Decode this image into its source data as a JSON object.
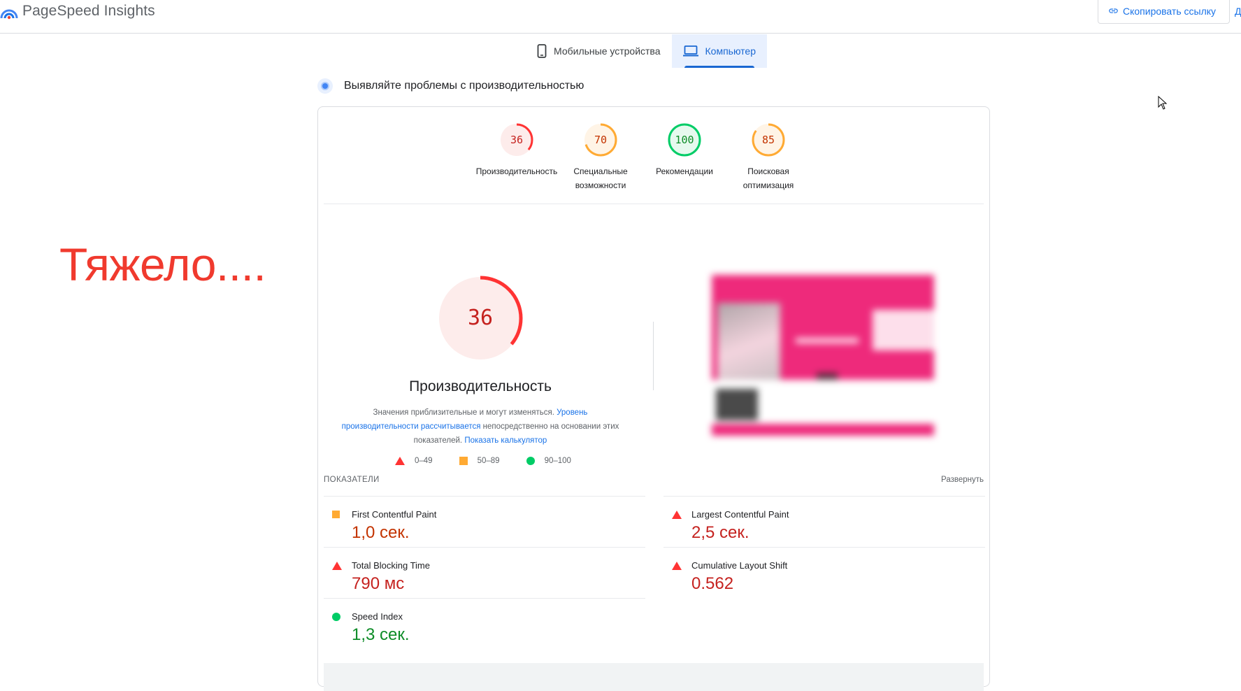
{
  "header": {
    "app_title": "PageSpeed Insights",
    "copy_link_label": "Скопировать ссылку",
    "edge_letter": "Д"
  },
  "tabs": [
    {
      "label": "Мобильные устройства",
      "active": false
    },
    {
      "label": "Компьютер",
      "active": true
    }
  ],
  "section_title": "Выявляйте проблемы с производительностью",
  "caption": "Тяжело....",
  "categories": [
    {
      "score": "36",
      "label": "Производительность",
      "level": "fail",
      "fraction": 0.36
    },
    {
      "score": "70",
      "label": "Специальные возможности",
      "level": "average",
      "fraction": 0.7
    },
    {
      "score": "100",
      "label": "Рекомендации",
      "level": "pass",
      "fraction": 1.0
    },
    {
      "score": "85",
      "label": "Поисковая оптимизация",
      "level": "average",
      "fraction": 0.85
    }
  ],
  "performance": {
    "score": "36",
    "fraction": 0.36,
    "title": "Производительность",
    "note_part1": "Значения приблизительные и могут изменяться.",
    "note_link1": "Уровень производительности рассчитывается",
    "note_part2": "непосредственно на основании этих показателей.",
    "note_link2": "Показать калькулятор"
  },
  "legend": [
    {
      "range": "0–49",
      "symbol": "triangle"
    },
    {
      "range": "50–89",
      "symbol": "square"
    },
    {
      "range": "90–100",
      "symbol": "circle"
    }
  ],
  "metrics_section": {
    "title": "ПОКАЗАТЕЛИ",
    "expand_label": "Развернуть"
  },
  "metrics": [
    {
      "name": "First Contentful Paint",
      "value": "1,0 сек.",
      "level": "average"
    },
    {
      "name": "Largest Contentful Paint",
      "value": "2,5 сек.",
      "level": "fail"
    },
    {
      "name": "Total Blocking Time",
      "value": "790 мс",
      "level": "fail"
    },
    {
      "name": "Cumulative Layout Shift",
      "value": "0.562",
      "level": "fail"
    },
    {
      "name": "Speed Index",
      "value": "1,3 сек.",
      "level": "pass"
    }
  ],
  "colors": {
    "fail": "#ff3333",
    "average": "#ffaa33",
    "pass": "#00cc66",
    "accent": "#1a73e8"
  }
}
